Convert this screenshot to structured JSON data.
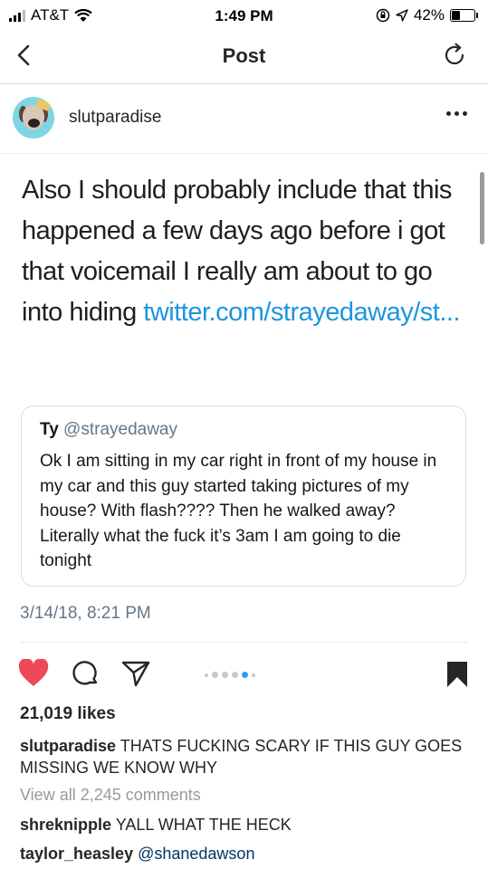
{
  "status_bar": {
    "carrier": "AT&T",
    "time": "1:49 PM",
    "battery": "42%",
    "battery_level": 0.42
  },
  "nav": {
    "title": "Post"
  },
  "post": {
    "username": "slutparadise",
    "text": "Also I should probably include that this happened a few days ago before i got that voicemail I really am about to go into hiding ",
    "link": "twitter.com/strayedaway/st...",
    "quote": {
      "name": "Ty",
      "handle": "@strayedaway",
      "body": "Ok I am sitting in my car right in front of my house in my car and this guy started taking pictures of my house? With flash???? Then he walked away? Literally what the fuck it’s 3am I am going to die tonight"
    },
    "timestamp": "3/14/18, 8:21 PM",
    "likes": "21,019 likes",
    "caption": {
      "user": "slutparadise",
      "text": "THATS FUCKING SCARY IF THIS GUY GOES MISSING WE KNOW WHY"
    },
    "view_all": "View all 2,245 comments",
    "comments": [
      {
        "user": "shreknipple",
        "text": "YALL WHAT THE HECK"
      },
      {
        "user": "taylor_heasley",
        "text": "@shanedawson"
      }
    ],
    "carousel": {
      "count": 6,
      "active_index": 4
    }
  },
  "colors": {
    "heart": "#ed4956",
    "link": "#1b95e0",
    "mention": "#003569"
  }
}
